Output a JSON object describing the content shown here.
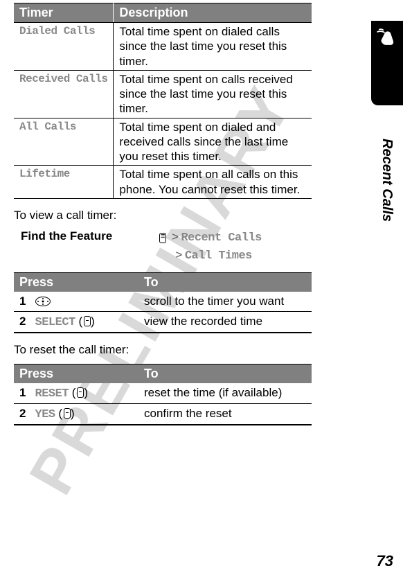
{
  "side_label": "Recent Calls",
  "page_number": "73",
  "watermark": "PRELIMINARY",
  "timer_table": {
    "headers": [
      "Timer",
      "Description"
    ],
    "rows": [
      {
        "timer": "Dialed Calls",
        "desc": "Total time spent on dialed calls since the last time you reset this timer."
      },
      {
        "timer": "Received Calls",
        "desc": "Total time spent on calls received since the last time you reset this timer."
      },
      {
        "timer": "All Calls",
        "desc": "Total time spent on dialed and received calls since the last time you reset this timer."
      },
      {
        "timer": "Lifetime",
        "desc": "Total time spent on all calls on this phone. You cannot reset this timer."
      }
    ]
  },
  "intro_view": "To view a call timer:",
  "feature": {
    "label": "Find the Feature",
    "path1": "Recent Calls",
    "path2": "Call Times"
  },
  "press_table_1": {
    "headers": [
      "Press",
      "To"
    ],
    "rows": [
      {
        "num": "1",
        "key_type": "nav",
        "to": "scroll to the timer you want"
      },
      {
        "num": "2",
        "key_type": "soft",
        "softkey": "SELECT",
        "to": "view the recorded time"
      }
    ]
  },
  "intro_reset": "To reset the call timer:",
  "press_table_2": {
    "headers": [
      "Press",
      "To"
    ],
    "rows": [
      {
        "num": "1",
        "key_type": "soft",
        "softkey": "RESET",
        "to": "reset the time (if available)"
      },
      {
        "num": "2",
        "key_type": "soft",
        "softkey": "YES",
        "to": "confirm the reset"
      }
    ]
  }
}
